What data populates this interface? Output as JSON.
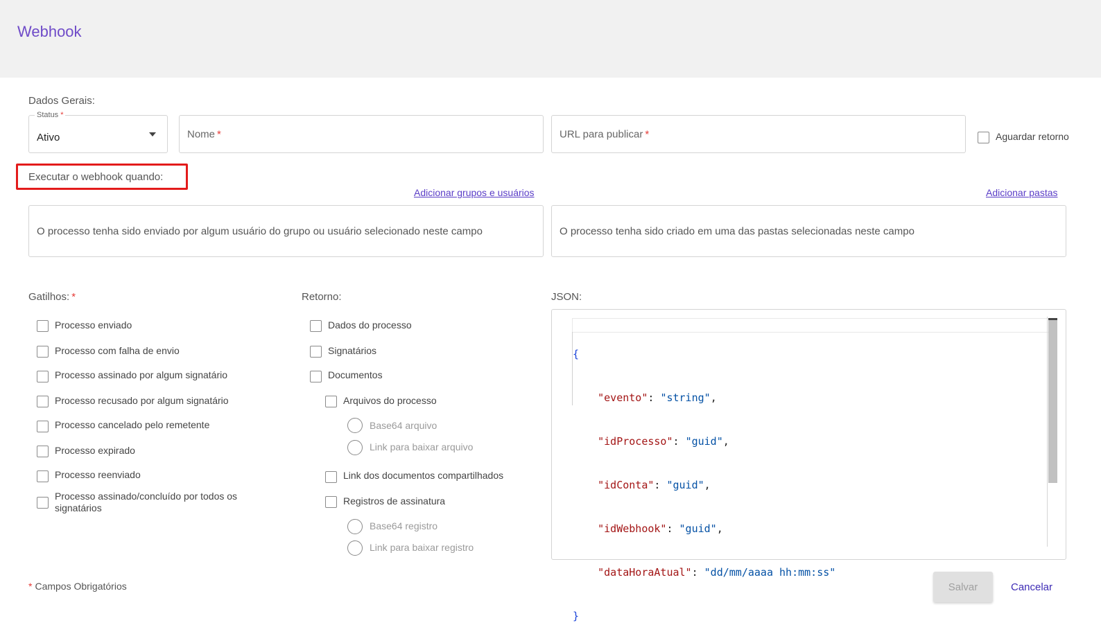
{
  "header": {
    "title": "Webhook"
  },
  "general": {
    "section_label": "Dados Gerais:",
    "status": {
      "legend": "Status",
      "value": "Ativo"
    },
    "name_placeholder": "Nome",
    "url_placeholder": "URL para publicar",
    "wait_return_label": "Aguardar retorno",
    "required_mark": "*"
  },
  "execute": {
    "section_label": "Executar o webhook quando:",
    "add_groups_link": "Adicionar grupos e usuários",
    "add_folders_link": "Adicionar pastas",
    "users_box_text": "O processo tenha sido enviado por algum usuário do grupo ou usuário selecionado neste campo",
    "folders_box_text": "O processo tenha sido criado em uma das pastas selecionadas neste campo"
  },
  "triggers": {
    "label": "Gatilhos:",
    "items": [
      "Processo enviado",
      "Processo com falha de envio",
      "Processo assinado por algum signatário",
      "Processo recusado por algum signatário",
      "Processo cancelado pelo remetente",
      "Processo expirado",
      "Processo reenviado",
      "Processo assinado/concluído por todos os signatários"
    ]
  },
  "return": {
    "label": "Retorno:",
    "process_data": "Dados do processo",
    "signers": "Signatários",
    "documents": "Documentos",
    "process_files": "Arquivos do processo",
    "file_base64": "Base64 arquivo",
    "file_link": "Link para baixar arquivo",
    "shared_docs_link": "Link dos documentos compartilhados",
    "signature_records": "Registros de assinatura",
    "record_base64": "Base64 registro",
    "record_link": "Link para baixar registro"
  },
  "json": {
    "label": "JSON:",
    "open_brace": "{",
    "close_brace": "}",
    "fields": [
      {
        "key": "\"evento\"",
        "value": "\"string\"",
        "comma": ","
      },
      {
        "key": "\"idProcesso\"",
        "value": "\"guid\"",
        "comma": ","
      },
      {
        "key": "\"idConta\"",
        "value": "\"guid\"",
        "comma": ","
      },
      {
        "key": "\"idWebhook\"",
        "value": "\"guid\"",
        "comma": ","
      },
      {
        "key": "\"dataHoraAtual\"",
        "value": "\"dd/mm/aaaa hh:mm:ss\"",
        "comma": ""
      }
    ]
  },
  "footer": {
    "required_note_mark": "*",
    "required_note": "Campos Obrigatórios",
    "save_label": "Salvar",
    "cancel_label": "Cancelar"
  },
  "colors": {
    "accent": "#6f4bc8",
    "link": "#5a3dc7",
    "required": "#e53935",
    "highlight": "#e31b1b"
  }
}
